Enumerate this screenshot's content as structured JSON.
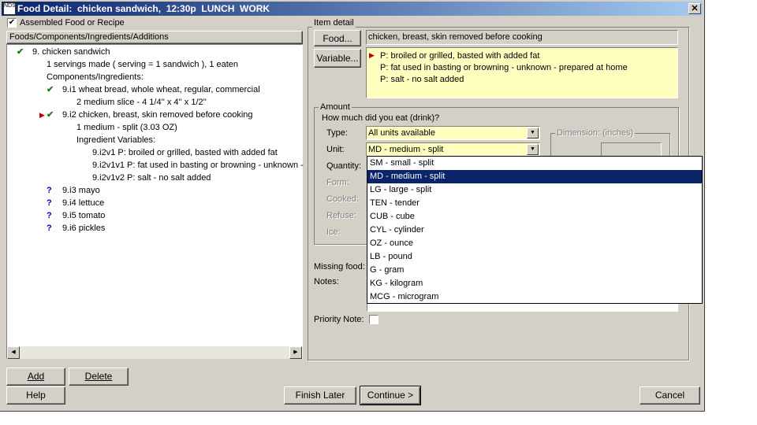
{
  "window": {
    "title": "Food Detail:  chicken sandwich,  12:30p  LUNCH  WORK",
    "close": "✕"
  },
  "left": {
    "assembled_label": "Assembled Food or Recipe",
    "assembled_checked": true,
    "header": "Foods/Components/Ingredients/Additions",
    "tree": [
      {
        "mark": "check",
        "text": "9.  chicken sandwich"
      },
      {
        "mark": "",
        "text": "1 servings made ( serving = 1 sandwich ), 1 eaten"
      },
      {
        "mark": "",
        "text": "Components/Ingredients:"
      },
      {
        "mark": "check",
        "text": "9.i1  wheat bread, whole wheat, regular, commercial"
      },
      {
        "mark": "",
        "text": "2 medium slice - 4 1/4'' x 4'' x 1/2''"
      },
      {
        "mark": "check",
        "text": "9.i2  chicken, breast, skin removed before cooking",
        "current": true
      },
      {
        "mark": "",
        "text": "1 medium - split (3.03 OZ)"
      },
      {
        "mark": "",
        "text": "Ingredient Variables:"
      },
      {
        "mark": "",
        "text": "9.i2v1  P: broiled or grilled, basted with added fat"
      },
      {
        "mark": "",
        "text": "9.i2v1v1  P: fat used in basting or browning - unknown -"
      },
      {
        "mark": "",
        "text": "9.i2v1v2  P: salt - no salt added"
      },
      {
        "mark": "question",
        "text": "9.i3  mayo"
      },
      {
        "mark": "question",
        "text": "9.i4  lettuce"
      },
      {
        "mark": "question",
        "text": "9.i5  tomato"
      },
      {
        "mark": "question",
        "text": "9.i6  pickles"
      }
    ]
  },
  "item": {
    "group_label": "Item detail",
    "food_button": "Food...",
    "food_value": "chicken, breast, skin removed before cooking",
    "variable_button": "Variable...",
    "variables": [
      "P: broiled or grilled, basted with added fat",
      "P: fat used in basting or browning - unknown - prepared at home",
      "P: salt - no salt added"
    ]
  },
  "amount": {
    "group_label": "Amount",
    "question": "How much did you eat (drink)?",
    "type_label": "Type:",
    "type_value": "All units available",
    "unit_label": "Unit:",
    "unit_value": "MD - medium - split",
    "quantity_label": "Quantity:",
    "form_label": "Form:",
    "cooked_label": "Cooked:",
    "refuse_label": "Refuse:",
    "ice_label": "Ice:",
    "dimension_label": "Dimension: (inches)",
    "unit_options": [
      "SM - small - split",
      "MD - medium - split",
      "LG - large - split",
      "TEN - tender",
      "CUB - cube",
      "CYL - cylinder",
      "OZ - ounce",
      "LB - pound",
      "G - gram",
      "KG - kilogram",
      "MCG - microgram"
    ],
    "selected_index": 1
  },
  "missing_food_label": "Missing food:",
  "notes_label": "Notes:",
  "priority_note_label": "Priority Note:",
  "buttons": {
    "add": "Add",
    "delete": "Delete",
    "help": "Help",
    "finish_later": "Finish Later",
    "continue": "Continue >",
    "cancel": "Cancel"
  }
}
